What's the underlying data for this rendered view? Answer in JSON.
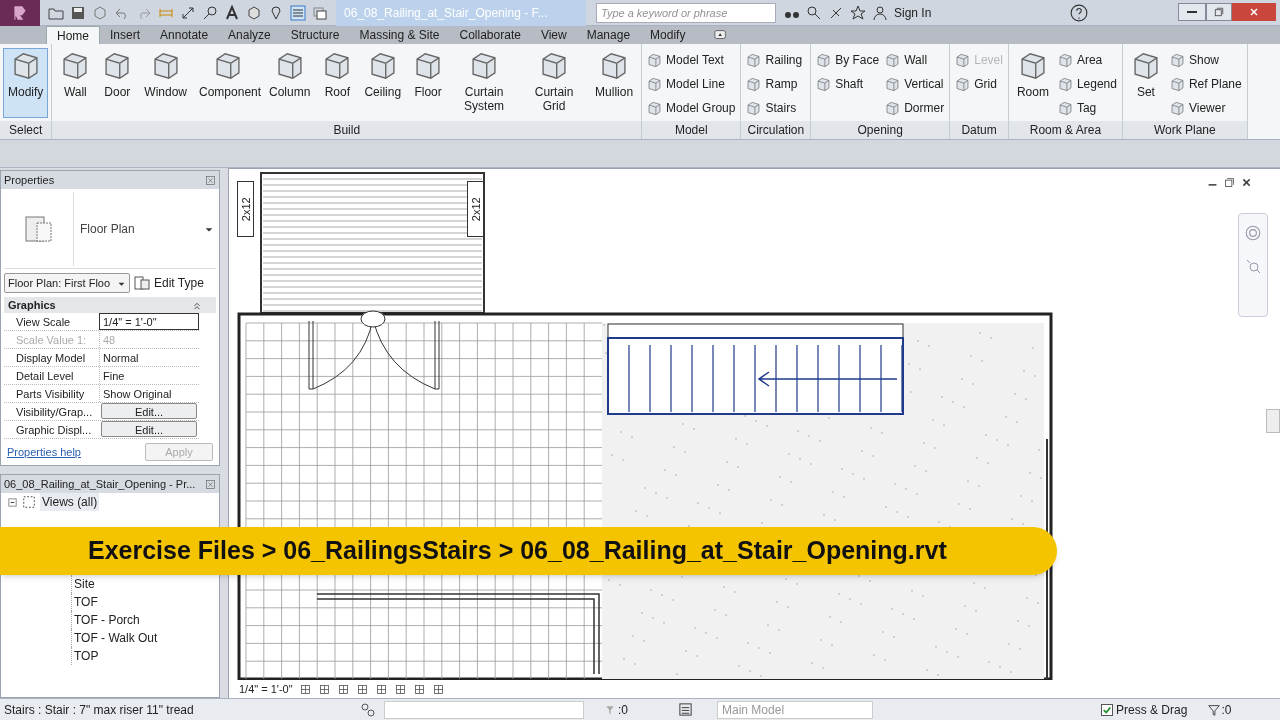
{
  "title_bar": {
    "title": "06_08_Railing_at_Stair_Opening - F...",
    "search_placeholder": "Type a keyword or phrase",
    "sign_in": "Sign In"
  },
  "tabs": [
    {
      "label": "Home",
      "selected": true
    },
    {
      "label": "Insert",
      "selected": false
    },
    {
      "label": "Annotate",
      "selected": false
    },
    {
      "label": "Analyze",
      "selected": false
    },
    {
      "label": "Structure",
      "selected": false
    },
    {
      "label": "Massing & Site",
      "selected": false
    },
    {
      "label": "Collaborate",
      "selected": false
    },
    {
      "label": "View",
      "selected": false
    },
    {
      "label": "Manage",
      "selected": false
    },
    {
      "label": "Modify",
      "selected": false
    }
  ],
  "ribbon_panels": [
    {
      "title": "Select",
      "tools": [
        {
          "label": "Modify",
          "kind": "large",
          "selected": true
        }
      ]
    },
    {
      "title": "Build",
      "tools": [
        {
          "label": "Wall",
          "kind": "large",
          "selected": false
        },
        {
          "label": "Door",
          "kind": "large",
          "selected": false
        },
        {
          "label": "Window",
          "kind": "large",
          "selected": false
        },
        {
          "label": "Component",
          "kind": "large",
          "selected": false
        },
        {
          "label": "Column",
          "kind": "large",
          "selected": false
        },
        {
          "label": "Roof",
          "kind": "large",
          "selected": false
        },
        {
          "label": "Ceiling",
          "kind": "large",
          "selected": false
        },
        {
          "label": "Floor",
          "kind": "large",
          "selected": false
        },
        {
          "label": "Curtain System",
          "kind": "large",
          "selected": false
        },
        {
          "label": "Curtain Grid",
          "kind": "large",
          "selected": false
        },
        {
          "label": "Mullion",
          "kind": "large",
          "selected": false
        }
      ]
    },
    {
      "title": "Model",
      "tools": [
        {
          "kind": "stack",
          "tools": [
            {
              "label": "Model Text",
              "disabled": false
            },
            {
              "label": "Model Line",
              "disabled": false
            },
            {
              "label": "Model Group",
              "disabled": false
            }
          ]
        }
      ]
    },
    {
      "title": "Circulation",
      "tools": [
        {
          "kind": "stack",
          "tools": [
            {
              "label": "Railing",
              "disabled": false
            },
            {
              "label": "Ramp",
              "disabled": false
            },
            {
              "label": "Stairs",
              "disabled": false
            }
          ]
        }
      ]
    },
    {
      "title": "Opening",
      "tools": [
        {
          "kind": "stack",
          "tools": [
            {
              "label": "By Face",
              "disabled": false
            },
            {
              "label": "Shaft",
              "disabled": false
            }
          ]
        },
        {
          "kind": "stack",
          "tools": [
            {
              "label": "Wall",
              "disabled": false
            },
            {
              "label": "Vertical",
              "disabled": false
            },
            {
              "label": "Dormer",
              "disabled": false
            }
          ]
        }
      ]
    },
    {
      "title": "Datum",
      "tools": [
        {
          "kind": "stack",
          "tools": [
            {
              "label": "Level",
              "disabled": true
            },
            {
              "label": "Grid",
              "disabled": false
            }
          ]
        }
      ]
    },
    {
      "title": "Room & Area",
      "tools": [
        {
          "label": "Room",
          "kind": "large",
          "selected": false
        },
        {
          "kind": "stack",
          "tools": [
            {
              "label": "Area",
              "disabled": false
            },
            {
              "label": "Legend",
              "disabled": false
            },
            {
              "label": "Tag",
              "disabled": false
            }
          ]
        }
      ]
    },
    {
      "title": "Work Plane",
      "tools": [
        {
          "label": "Set",
          "kind": "large",
          "selected": false
        },
        {
          "kind": "stack",
          "tools": [
            {
              "label": "Show",
              "disabled": false
            },
            {
              "label": "Ref Plane",
              "disabled": false
            },
            {
              "label": "Viewer",
              "disabled": false
            }
          ]
        }
      ]
    }
  ],
  "properties": {
    "title": "Properties",
    "type_name": "Floor Plan",
    "view_selector": "Floor Plan: First Floo",
    "edit_type": "Edit Type",
    "group": "Graphics",
    "rows": [
      {
        "label": "View Scale",
        "value": "1/4\" = 1'-0\"",
        "kind": "field"
      },
      {
        "label": "Scale Value 1:",
        "value": "48",
        "kind": "disabled"
      },
      {
        "label": "Display Model",
        "value": "Normal",
        "kind": "text"
      },
      {
        "label": "Detail Level",
        "value": "Fine",
        "kind": "text"
      },
      {
        "label": "Parts Visibility",
        "value": "Show Original",
        "kind": "text"
      },
      {
        "label": "Visibility/Grap...",
        "value": "Edit...",
        "kind": "button"
      },
      {
        "label": "Graphic Displ...",
        "value": "Edit...",
        "kind": "button"
      }
    ],
    "help": "Properties help",
    "apply": "Apply"
  },
  "project_browser": {
    "title": "06_08_Railing_at_Stair_Opening - Pr...",
    "root": {
      "label": "Views (all)",
      "selected": true
    },
    "items": [
      {
        "label": "Site",
        "selected": false
      },
      {
        "label": "TOF",
        "selected": false
      },
      {
        "label": "TOF - Porch",
        "selected": false
      },
      {
        "label": "TOF - Walk Out",
        "selected": false
      },
      {
        "label": "TOP",
        "selected": false
      }
    ]
  },
  "drawing": {
    "tags": [
      "2x12",
      "2x12"
    ],
    "view_scale": "1/4\" = 1'-0\""
  },
  "banner": "Exercise Files > 06_RailingsStairs > 06_08_Railing_at_Stair_Opening.rvt",
  "status_bar": {
    "text": "Stairs : Stair : 7\" max riser 11\" tread",
    "count": ":0",
    "model": "Main Model",
    "press_drag": {
      "label": "Press & Drag",
      "checked": true
    },
    "filter_count": ":0"
  }
}
